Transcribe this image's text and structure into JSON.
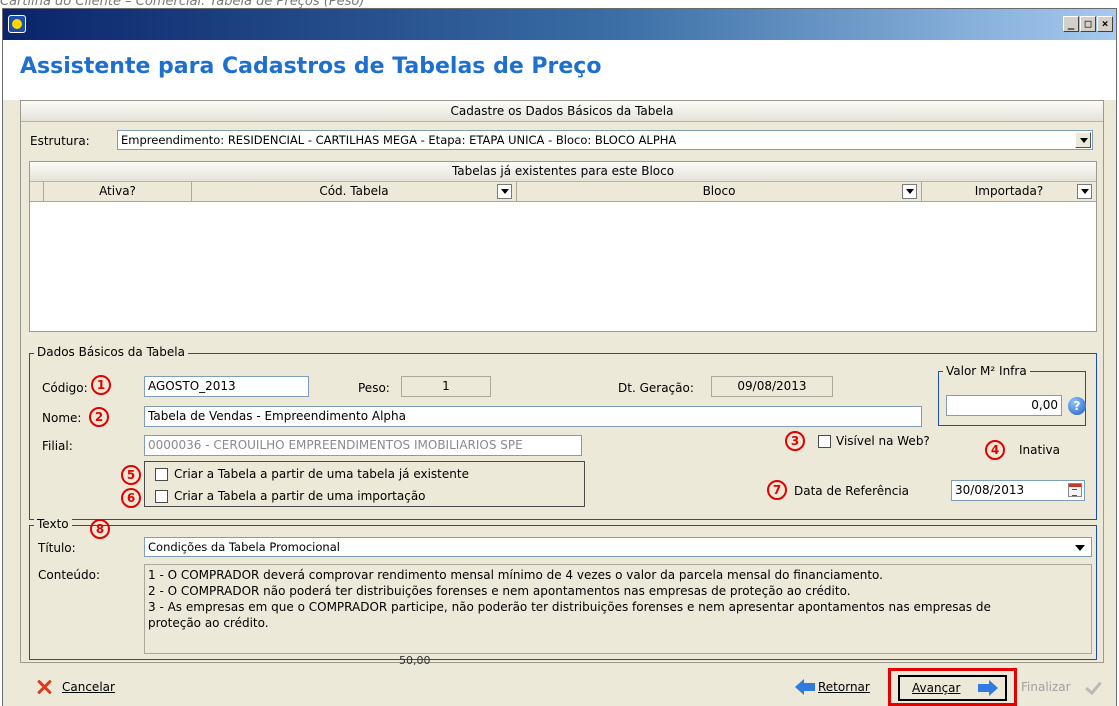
{
  "page_caption": "Cartilha do Cliente – Comercial: Tabela de Preços (Peso)",
  "window": {
    "title": "",
    "controls": [
      "minimize",
      "maximize",
      "close"
    ]
  },
  "header": {
    "title": "Assistente para Cadastros de Tabelas de Preço"
  },
  "basic_section": {
    "header": "Cadastre os Dados Básicos da Tabela",
    "estrutura_label": "Estrutura:",
    "estrutura_value": "Empreendimento: RESIDENCIAL - CARTILHAS MEGA - Etapa: ETAPA UNICA - Bloco: BLOCO ALPHA"
  },
  "existing_tables": {
    "header": "Tabelas já existentes para este Bloco",
    "columns": [
      "Ativa?",
      "Cód. Tabela",
      "Bloco",
      "Importada?"
    ],
    "rows": []
  },
  "dados_basicos": {
    "legend": "Dados Básicos da Tabela",
    "codigo_label": "Código:",
    "codigo_value": "AGOSTO_2013",
    "peso_label": "Peso:",
    "peso_value": "1",
    "dt_geracao_label": "Dt. Geração:",
    "dt_geracao_value": "09/08/2013",
    "nome_label": "Nome:",
    "nome_value": "Tabela de Vendas - Empreendimento Alpha",
    "filial_label": "Filial:",
    "filial_value": "0000036 - CEROUILHO EMPREENDIMENTOS IMOBILIARIOS SPE",
    "visivel_web_label": "Visível na Web?",
    "inativa_label": "Inativa",
    "criar_existente_label": "Criar a Tabela a partir de uma tabela já existente",
    "criar_importacao_label": "Criar a Tabela a partir de uma importação",
    "data_referencia_label": "Data de Referência",
    "data_referencia_value": "30/08/2013",
    "valor_m2_legend": "Valor M² Infra",
    "valor_m2_value": "0,00"
  },
  "texto": {
    "legend": "Texto",
    "titulo_label": "Título:",
    "titulo_value": "Condições da Tabela Promocional",
    "conteudo_label": "Conteúdo:",
    "conteudo_lines": [
      "1 - O COMPRADOR deverá comprovar rendimento mensal mínimo de 4 vezes o valor da parcela mensal do financiamento.",
      "2 - O COMPRADOR não poderá ter distribuições forenses e nem apontamentos nas empresas de proteção ao crédito.",
      "3 - As empresas em que o COMPRADOR participe, não poderão ter distribuições forenses e nem apresentar apontamentos nas empresas de",
      "proteção ao crédito."
    ]
  },
  "annotations": {
    "n1": "1",
    "n2": "2",
    "n3": "3",
    "n4": "4",
    "n5": "5",
    "n6": "6",
    "n7": "7",
    "n8": "8",
    "color": "#e30000"
  },
  "ghost_value": "50,00",
  "footer": {
    "cancel_label": "Cancelar",
    "back_label": "Retornar",
    "next_label": "Avançar",
    "finish_label": "Finalizar",
    "highlight_color": "#e30000"
  },
  "colors": {
    "header_title": "#1d6fd0",
    "group_border": "#1e4fa8",
    "panel": "#ece9d8"
  }
}
